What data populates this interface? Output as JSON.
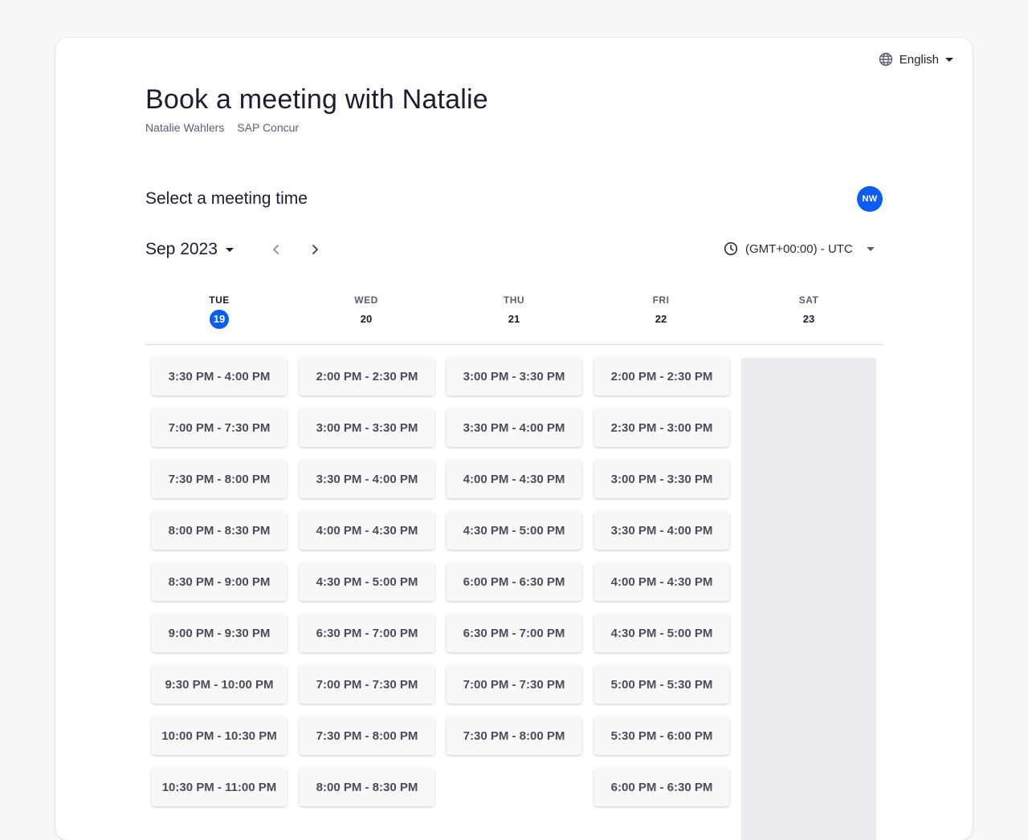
{
  "header": {
    "language": "English",
    "title": "Book a meeting with Natalie",
    "host_name": "Natalie Wahlers",
    "company": "SAP Concur"
  },
  "scheduler": {
    "heading": "Select a meeting time",
    "avatar_initials": "NW",
    "month": "Sep 2023",
    "timezone": "(GMT+00:00) - UTC"
  },
  "days": [
    {
      "name": "TUE",
      "num": "19",
      "today": true
    },
    {
      "name": "WED",
      "num": "20",
      "today": false
    },
    {
      "name": "THU",
      "num": "21",
      "today": false
    },
    {
      "name": "FRI",
      "num": "22",
      "today": false
    },
    {
      "name": "SAT",
      "num": "23",
      "today": false
    }
  ],
  "slots": {
    "tue": [
      "3:30 PM - 4:00 PM",
      "7:00 PM - 7:30 PM",
      "7:30 PM - 8:00 PM",
      "8:00 PM - 8:30 PM",
      "8:30 PM - 9:00 PM",
      "9:00 PM - 9:30 PM",
      "9:30 PM - 10:00 PM",
      "10:00 PM - 10:30 PM",
      "10:30 PM - 11:00 PM"
    ],
    "wed": [
      "2:00 PM - 2:30 PM",
      "3:00 PM - 3:30 PM",
      "3:30 PM - 4:00 PM",
      "4:00 PM - 4:30 PM",
      "4:30 PM - 5:00 PM",
      "6:30 PM - 7:00 PM",
      "7:00 PM - 7:30 PM",
      "7:30 PM - 8:00 PM",
      "8:00 PM - 8:30 PM"
    ],
    "thu": [
      "3:00 PM - 3:30 PM",
      "3:30 PM - 4:00 PM",
      "4:00 PM - 4:30 PM",
      "4:30 PM - 5:00 PM",
      "6:00 PM - 6:30 PM",
      "6:30 PM - 7:00 PM",
      "7:00 PM - 7:30 PM",
      "7:30 PM - 8:00 PM"
    ],
    "fri": [
      "2:00 PM - 2:30 PM",
      "2:30 PM - 3:00 PM",
      "3:00 PM - 3:30 PM",
      "3:30 PM - 4:00 PM",
      "4:00 PM - 4:30 PM",
      "4:30 PM - 5:00 PM",
      "5:00 PM - 5:30 PM",
      "5:30 PM - 6:00 PM",
      "6:00 PM - 6:30 PM"
    ],
    "sat": []
  },
  "colors": {
    "accent": "#0a5df0",
    "unavailable": "#ececf1"
  }
}
